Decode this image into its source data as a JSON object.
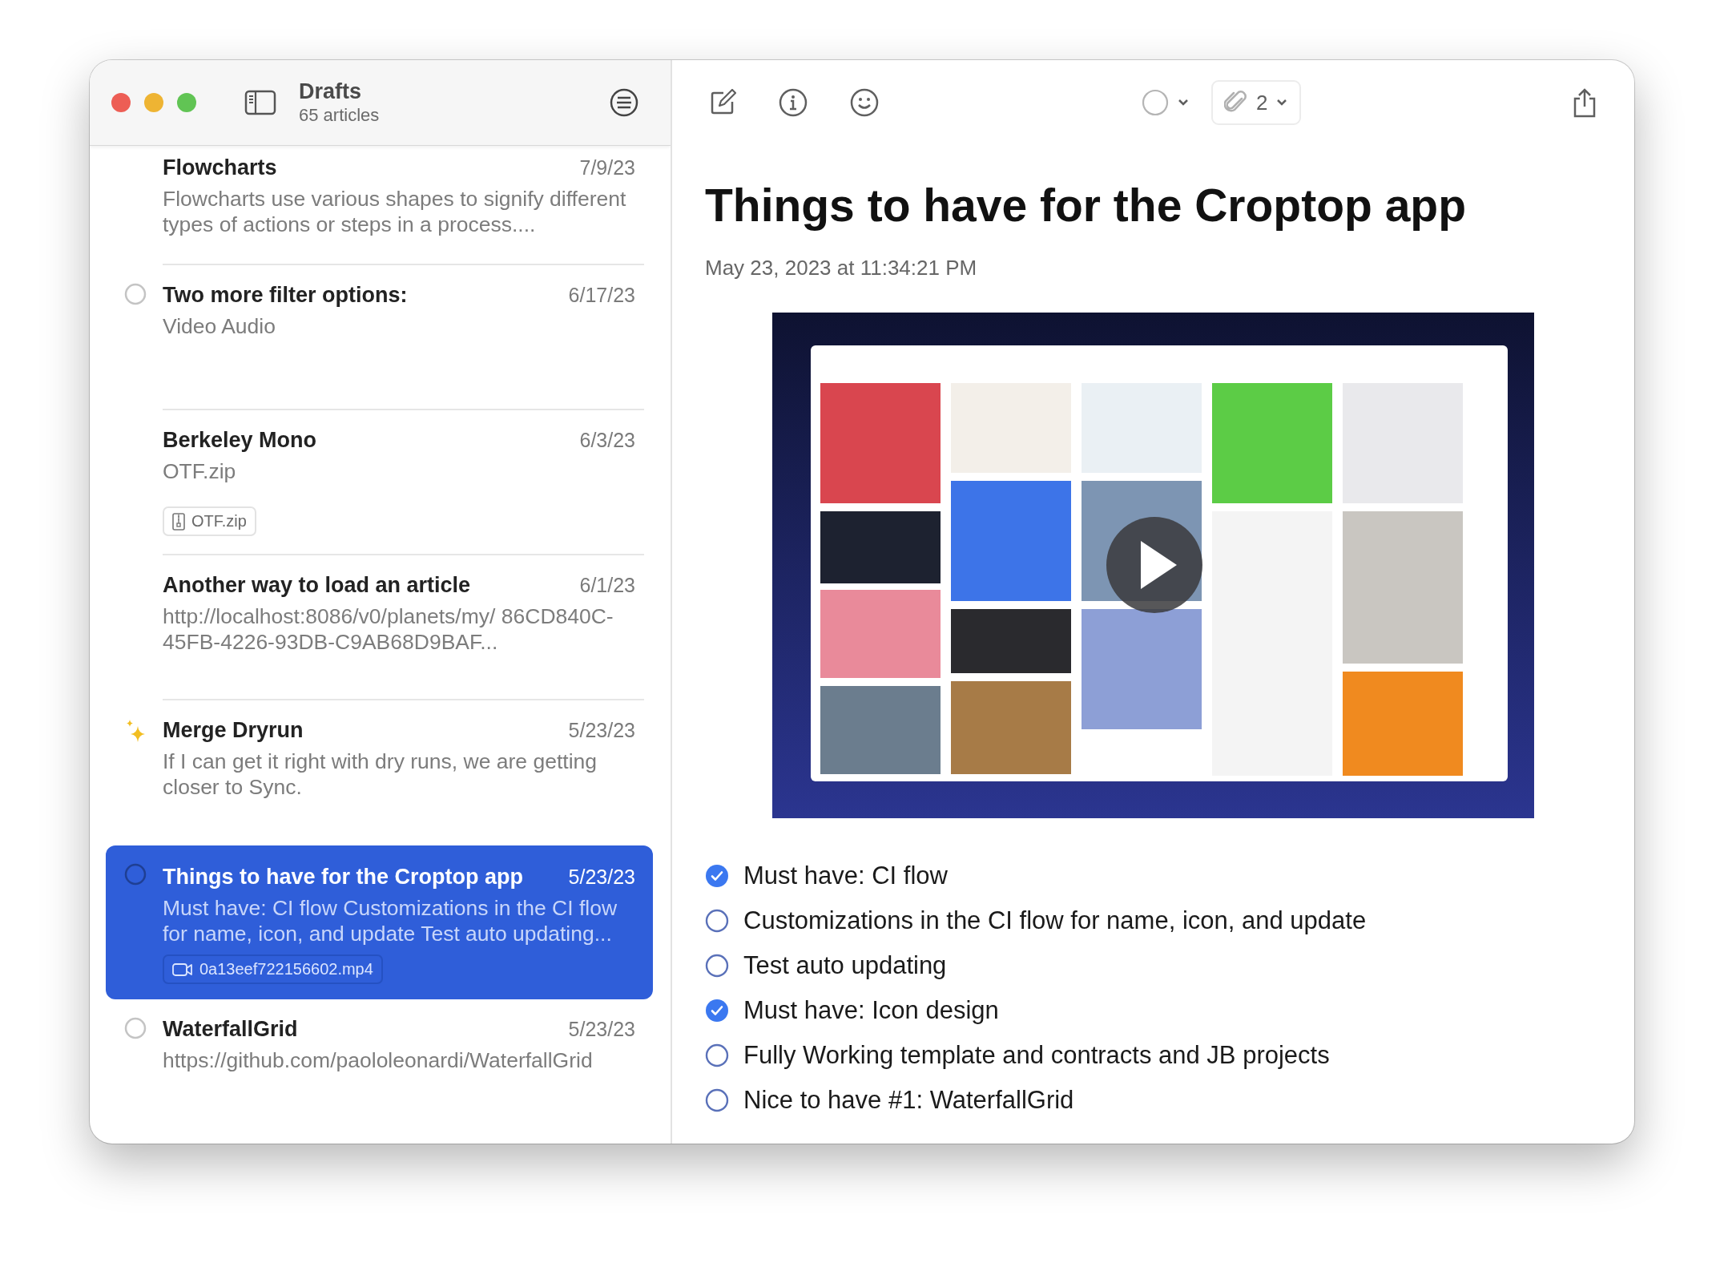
{
  "sidebar": {
    "title": "Drafts",
    "subtitle": "65 articles",
    "articles": [
      {
        "title": "Flowcharts",
        "date": "7/9/23",
        "preview": "Flowcharts use various shapes to signify different types of actions or steps in a process....",
        "kind": "plain",
        "selected": false
      },
      {
        "title": "Two more filter options:",
        "date": "6/17/23",
        "preview": "Video Audio",
        "kind": "task",
        "selected": false
      },
      {
        "title": "Berkeley Mono",
        "date": "6/3/23",
        "preview": "OTF.zip",
        "kind": "plain",
        "selected": false,
        "attachment": {
          "kind": "archive",
          "name": "OTF.zip"
        }
      },
      {
        "title": "Another way to load an article",
        "date": "6/1/23",
        "preview": "http://localhost:8086/v0/planets/my/ 86CD840C-45FB-4226-93DB-C9AB68D9BAF...",
        "kind": "plain",
        "selected": false
      },
      {
        "title": "Merge Dryrun",
        "date": "5/23/23",
        "preview": "If I can get it right with dry runs, we are getting closer to Sync.",
        "kind": "starred",
        "selected": false
      },
      {
        "title": "Things to have for the Croptop app",
        "date": "5/23/23",
        "preview": "Must have: CI flow Customizations in the CI flow for name, icon, and update Test auto updating...",
        "kind": "task",
        "selected": true,
        "attachment": {
          "kind": "video",
          "name": "0a13eef722156602.mp4"
        }
      },
      {
        "title": "WaterfallGrid",
        "date": "5/23/23",
        "preview": "https://github.com/paololeonardi/WaterfallGrid",
        "kind": "task",
        "selected": false
      }
    ]
  },
  "toolbar": {
    "attachment_count": "2"
  },
  "article": {
    "title": "Things to have for the Croptop app",
    "date": "May 23, 2023 at 11:34:21 PM",
    "checklist": [
      {
        "text": "Must have: CI flow",
        "checked": true
      },
      {
        "text": "Customizations in the CI flow for name, icon, and update",
        "checked": false
      },
      {
        "text": "Test auto updating",
        "checked": false
      },
      {
        "text": "Must have: Icon design",
        "checked": true
      },
      {
        "text": "Fully Working template and contracts and JB projects",
        "checked": false
      },
      {
        "text": "Nice to have #1: WaterfallGrid",
        "checked": false
      }
    ]
  }
}
